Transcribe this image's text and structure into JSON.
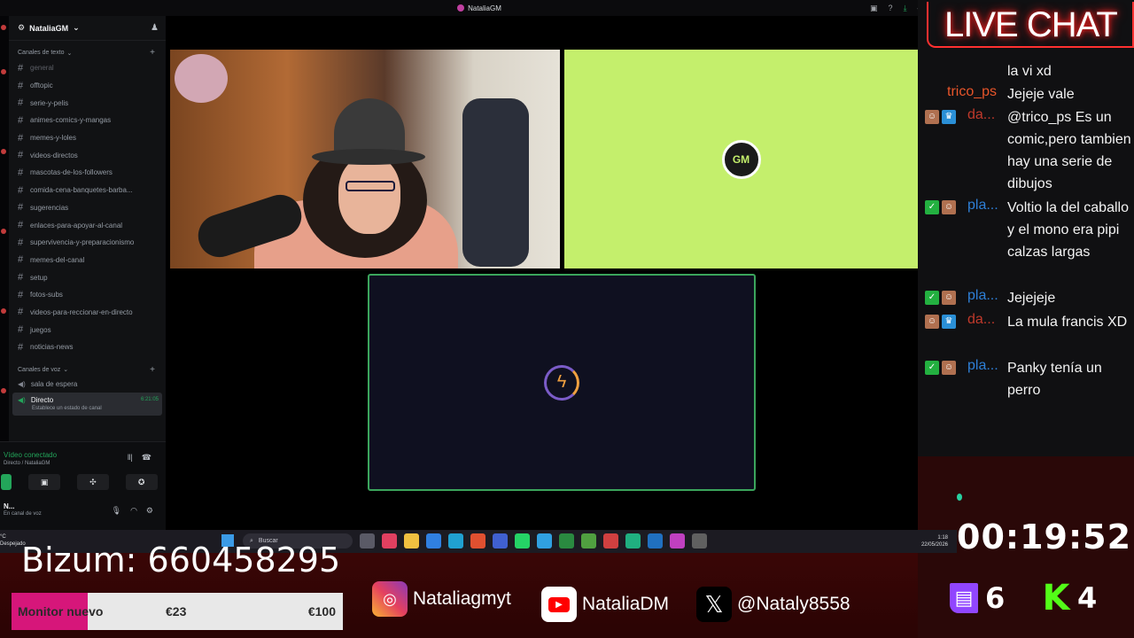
{
  "window": {
    "title": "NataliaGM"
  },
  "sidebar": {
    "server_name": "NataliaGM",
    "text_category": "Canales de texto",
    "text_channels": [
      "general",
      "offtopic",
      "serie-y-pelis",
      "animes-comics-y-mangas",
      "memes-y-loles",
      "videos-directos",
      "mascotas-de-los-followers",
      "comida-cena-banquetes-barba...",
      "sugerencias",
      "enlaces-para-apoyar-al-canal",
      "supervivencia-y-preparacionismo",
      "memes-del-canal",
      "setup",
      "fotos-subs",
      "videos-para-reccionar-en-directo",
      "juegos",
      "noticias-news"
    ],
    "voice_category": "Canales de voz",
    "voice_channels": [
      {
        "name": "sala de espera"
      },
      {
        "name": "Directo",
        "status": "Establece un estado de canal",
        "elapsed": "6:21:05"
      }
    ]
  },
  "voice_panel": {
    "status": "Vídeo conectado",
    "path": "Directo / NataliaGM",
    "user_initial": "N...",
    "user_status": "En canal de voz"
  },
  "chat": {
    "title": "LIVE CHAT",
    "messages": [
      {
        "user": "",
        "text": "la vi xd",
        "color": "#ffffff"
      },
      {
        "user": "trico_ps",
        "text": "Jejeje vale",
        "color": "#e8552a"
      },
      {
        "user": "da...",
        "text": "@trico_ps Es un comic,pero tambien hay una serie de dibujos",
        "color": "#c0392b"
      },
      {
        "user": "pla...",
        "text": "Voltio la del caballo y el mono era pipi calzas largas",
        "color": "#2e7fd6"
      },
      {
        "user": "pla...",
        "text": "Jejejeje",
        "color": "#2e7fd6"
      },
      {
        "user": "da...",
        "text": "La mula francis XD",
        "color": "#c0392b"
      },
      {
        "user": "pla...",
        "text": "Panky tenía un perro",
        "color": "#2e7fd6"
      }
    ]
  },
  "timer": "00:19:52",
  "taskbar": {
    "weather_temp": "°C",
    "weather_desc": "Despejado",
    "search_placeholder": "Buscar",
    "time": "1:18",
    "date": "22/05/2026"
  },
  "overlay": {
    "bizum": "Bizum: 660458295",
    "monitor": {
      "label": "Monitor nuevo",
      "current": "€23",
      "goal": "€100",
      "progress": 0.23
    },
    "instagram": "Nataliagmyt",
    "youtube": "NataliaDM",
    "x": "@Nataly8558",
    "twitch_count": "6",
    "kick_count": "4"
  }
}
